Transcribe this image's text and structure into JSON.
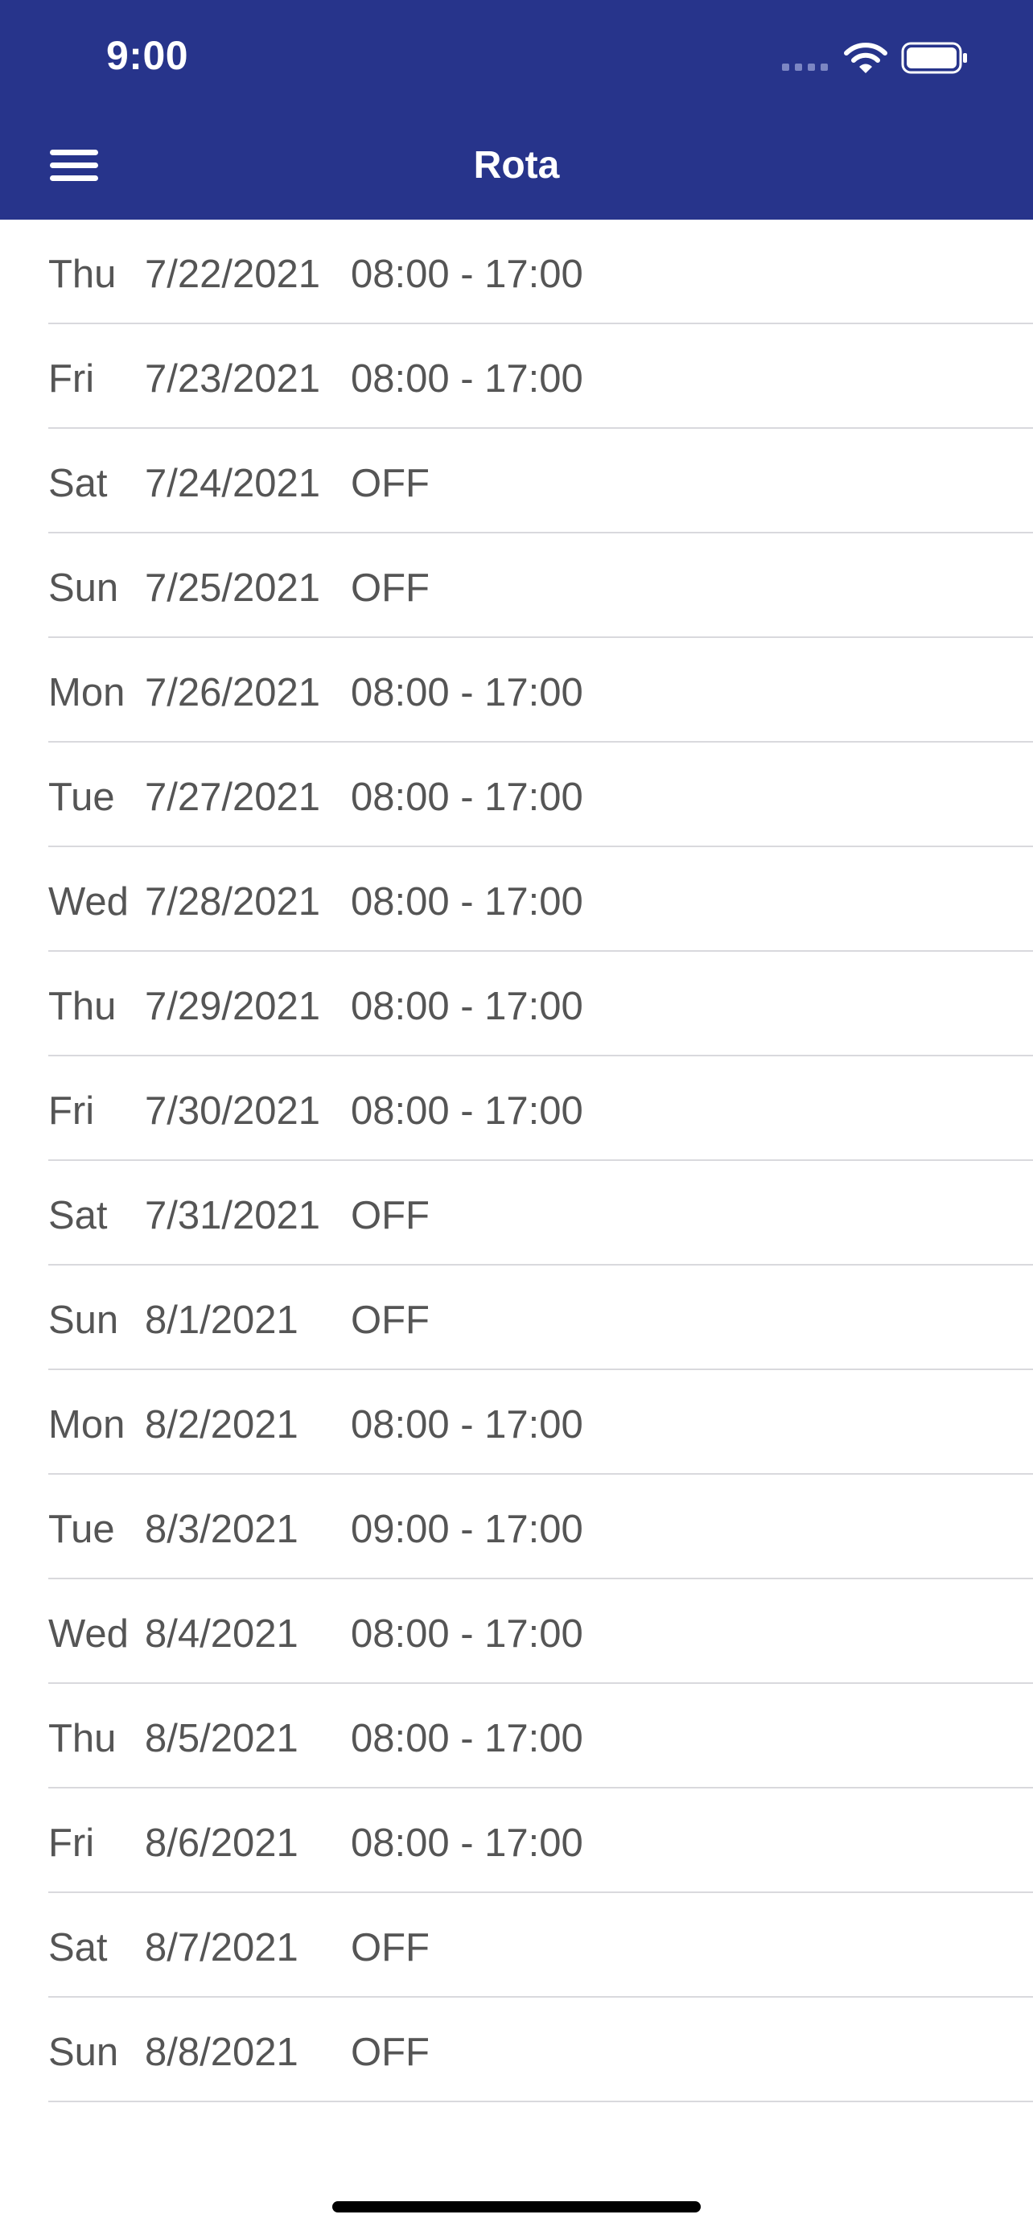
{
  "status_bar": {
    "time": "9:00"
  },
  "nav": {
    "title": "Rota",
    "menu_icon": "hamburger-menu-icon"
  },
  "colors": {
    "header_background": "#27348b",
    "header_text": "#ffffff",
    "row_text": "#555555",
    "separator": "#d9d9dd"
  },
  "rota": [
    {
      "day": "Thu",
      "date": "7/22/2021",
      "shift": "08:00 - 17:00"
    },
    {
      "day": "Fri",
      "date": "7/23/2021",
      "shift": "08:00 - 17:00"
    },
    {
      "day": "Sat",
      "date": "7/24/2021",
      "shift": "OFF"
    },
    {
      "day": "Sun",
      "date": "7/25/2021",
      "shift": "OFF"
    },
    {
      "day": "Mon",
      "date": "7/26/2021",
      "shift": "08:00 - 17:00"
    },
    {
      "day": "Tue",
      "date": "7/27/2021",
      "shift": "08:00 - 17:00"
    },
    {
      "day": "Wed",
      "date": "7/28/2021",
      "shift": "08:00 - 17:00"
    },
    {
      "day": "Thu",
      "date": "7/29/2021",
      "shift": "08:00 - 17:00"
    },
    {
      "day": "Fri",
      "date": "7/30/2021",
      "shift": "08:00 - 17:00"
    },
    {
      "day": "Sat",
      "date": "7/31/2021",
      "shift": "OFF"
    },
    {
      "day": "Sun",
      "date": "8/1/2021",
      "shift": "OFF"
    },
    {
      "day": "Mon",
      "date": "8/2/2021",
      "shift": "08:00 - 17:00"
    },
    {
      "day": "Tue",
      "date": "8/3/2021",
      "shift": "09:00 - 17:00"
    },
    {
      "day": "Wed",
      "date": "8/4/2021",
      "shift": "08:00 - 17:00"
    },
    {
      "day": "Thu",
      "date": "8/5/2021",
      "shift": "08:00 - 17:00"
    },
    {
      "day": "Fri",
      "date": "8/6/2021",
      "shift": "08:00 - 17:00"
    },
    {
      "day": "Sat",
      "date": "8/7/2021",
      "shift": "OFF"
    },
    {
      "day": "Sun",
      "date": "8/8/2021",
      "shift": "OFF"
    }
  ]
}
